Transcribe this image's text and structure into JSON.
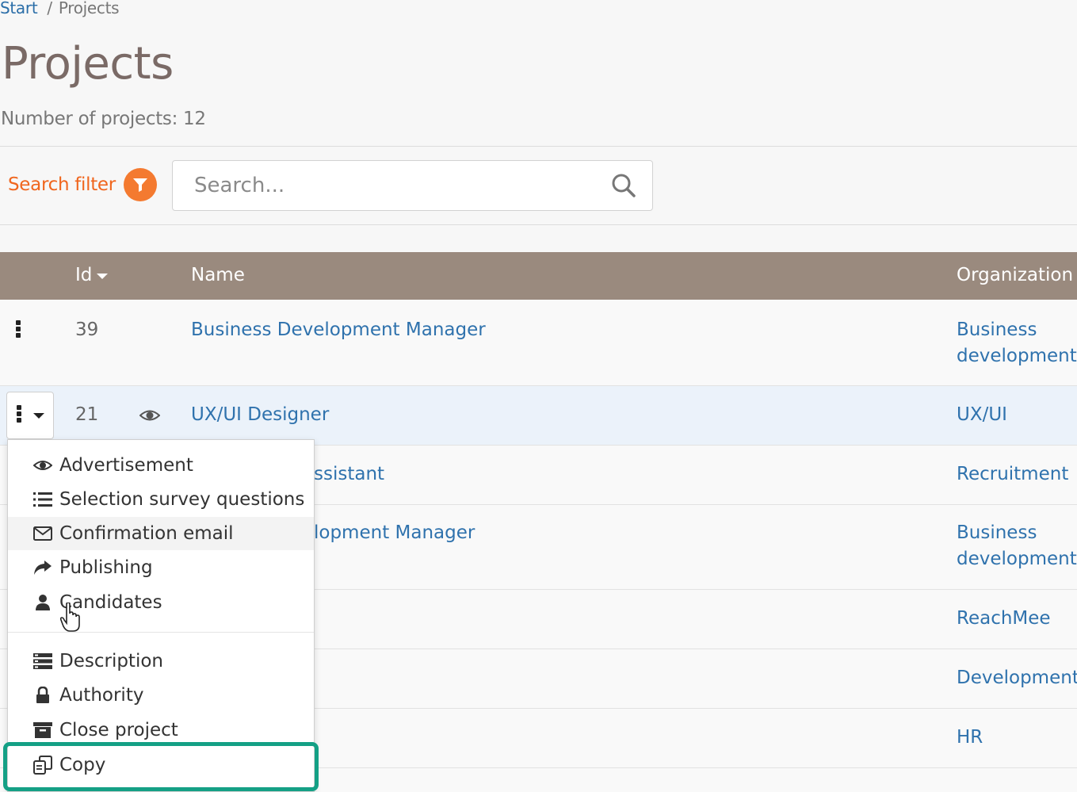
{
  "breadcrumb": {
    "start": "Start",
    "separator": "/",
    "current": "Projects"
  },
  "page": {
    "title": "Projects",
    "count_text": "Number of projects: 12"
  },
  "search": {
    "filter_label": "Search filter",
    "placeholder": "Search..."
  },
  "table": {
    "columns": {
      "id": "Id",
      "name": "Name",
      "organization": "Organization"
    },
    "rows": [
      {
        "id": "39",
        "name": "Business Development Manager",
        "organization": "Business\ndevelopment"
      },
      {
        "id": "21",
        "name": "UX/UI Designer",
        "organization": "UX/UI"
      },
      {
        "id": "",
        "name": "ssistant",
        "organization": "Recruitment"
      },
      {
        "id": "",
        "name": "lopment Manager",
        "organization": "Business\ndevelopment"
      },
      {
        "id": "",
        "name": "",
        "organization": "ReachMee"
      },
      {
        "id": "",
        "name": "",
        "organization": "Development"
      },
      {
        "id": "",
        "name": "",
        "organization": "HR"
      }
    ]
  },
  "menu": {
    "items": [
      {
        "label": "Advertisement",
        "icon": "eye-icon"
      },
      {
        "label": "Selection survey questions",
        "icon": "numbered-list-icon"
      },
      {
        "label": "Confirmation email",
        "icon": "envelope-icon"
      },
      {
        "label": "Publishing",
        "icon": "share-arrow-icon"
      },
      {
        "label": "Candidates",
        "icon": "user-icon"
      },
      {
        "label": "Description",
        "icon": "description-icon"
      },
      {
        "label": "Authority",
        "icon": "lock-icon"
      },
      {
        "label": "Close project",
        "icon": "archive-icon"
      },
      {
        "label": "Copy",
        "icon": "copy-icon"
      }
    ]
  },
  "colors": {
    "accent_orange": "#f0661e",
    "header_brown": "#9a8a7e",
    "link_blue": "#2f72ad",
    "highlight_green": "#14a085"
  }
}
